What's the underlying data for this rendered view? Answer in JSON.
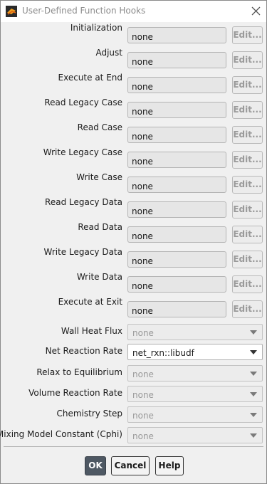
{
  "window": {
    "title": "User-Defined Function Hooks"
  },
  "hooks": [
    {
      "label": "Initialization",
      "value": "none",
      "button": "Edit..."
    },
    {
      "label": "Adjust",
      "value": "none",
      "button": "Edit..."
    },
    {
      "label": "Execute at End",
      "value": "none",
      "button": "Edit..."
    },
    {
      "label": "Read Legacy Case",
      "value": "none",
      "button": "Edit..."
    },
    {
      "label": "Read Case",
      "value": "none",
      "button": "Edit..."
    },
    {
      "label": "Write Legacy Case",
      "value": "none",
      "button": "Edit..."
    },
    {
      "label": "Write Case",
      "value": "none",
      "button": "Edit..."
    },
    {
      "label": "Read Legacy Data",
      "value": "none",
      "button": "Edit..."
    },
    {
      "label": "Read Data",
      "value": "none",
      "button": "Edit..."
    },
    {
      "label": "Write Legacy Data",
      "value": "none",
      "button": "Edit..."
    },
    {
      "label": "Write Data",
      "value": "none",
      "button": "Edit..."
    },
    {
      "label": "Execute at Exit",
      "value": "none",
      "button": "Edit..."
    }
  ],
  "selects": [
    {
      "label": "Wall Heat Flux",
      "value": "none"
    },
    {
      "label": "Net Reaction Rate",
      "value": "net_rxn::libudf"
    },
    {
      "label": "Relax to Equilibrium",
      "value": "none"
    },
    {
      "label": "Volume Reaction Rate",
      "value": "none"
    },
    {
      "label": "Chemistry Step",
      "value": "none"
    },
    {
      "label": "Mixing Model Constant (Cphi)",
      "value": "none"
    }
  ],
  "buttons": {
    "ok": "OK",
    "cancel": "Cancel",
    "help": "Help"
  },
  "icons": {
    "app": "fluent-app-icon",
    "close": "close-icon",
    "dropdown": "chevron-down-icon"
  },
  "colors": {
    "ok_button": "#4e5863",
    "field_bg": "#e6e6e6"
  }
}
